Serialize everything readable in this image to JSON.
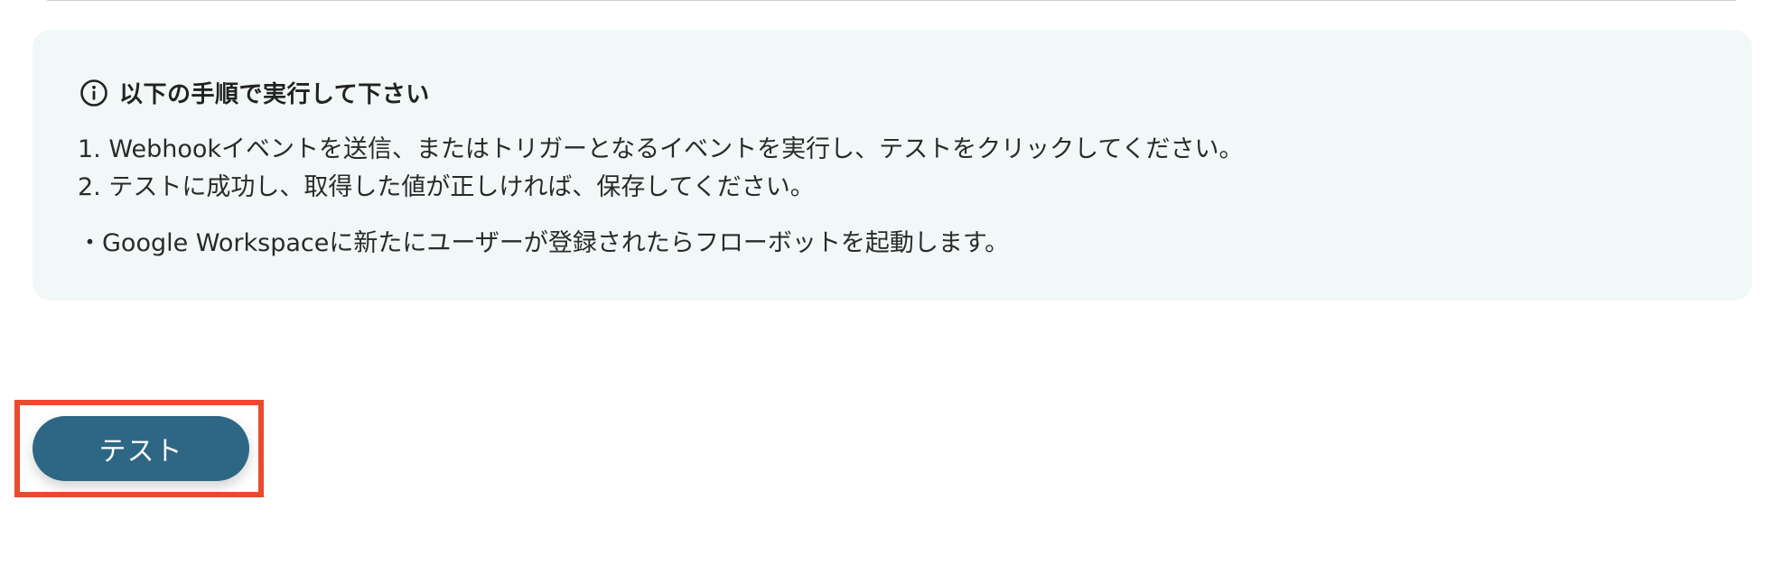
{
  "info_panel": {
    "title": "以下の手順で実行して下さい",
    "icon": "info-circle-icon",
    "steps": [
      "1. Webhookイベントを送信、またはトリガーとなるイベントを実行し、テストをクリックしてください。",
      "2. テストに成功し、取得した値が正しければ、保存してください。"
    ],
    "note": "・Google Workspaceに新たにユーザーが登録されたらフローボットを起動します。"
  },
  "actions": {
    "test_label": "テスト"
  },
  "colors": {
    "panel_background": "#f2f8f8",
    "button_background": "#2e6784",
    "highlight_border": "#ea4b2e"
  }
}
